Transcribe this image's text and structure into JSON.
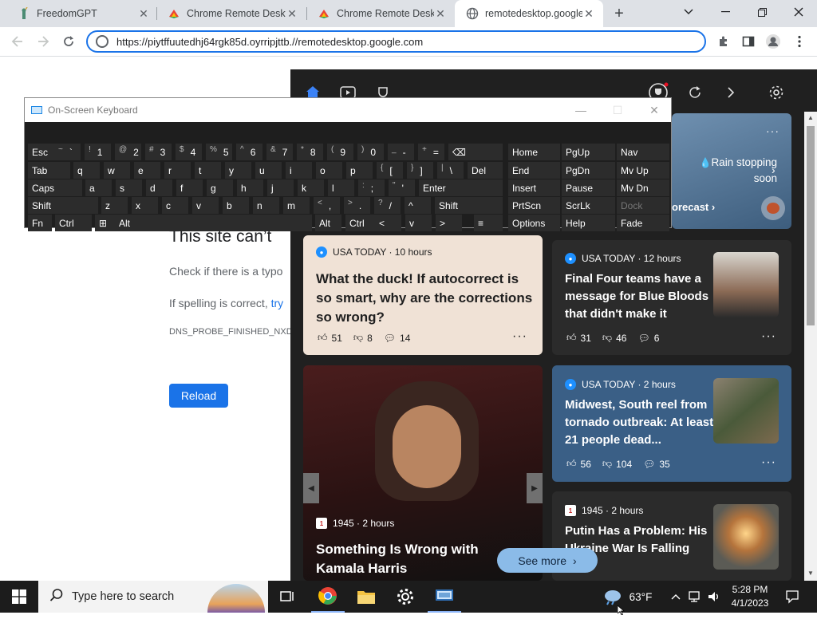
{
  "browser": {
    "tabs": [
      {
        "label": "FreedomGPT",
        "icon": "statue-of-liberty-icon",
        "active": false
      },
      {
        "label": "Chrome Remote Deskt",
        "icon": "chrome-remote-desktop-icon",
        "active": false
      },
      {
        "label": "Chrome Remote Deskt",
        "icon": "chrome-remote-desktop-icon",
        "active": false
      },
      {
        "label": "remotedesktop.google.",
        "icon": "globe-icon",
        "active": true
      }
    ],
    "new_tab": "+",
    "url": "https://piytffuutedhj64rgk85d.oyrripjttb.//remotedesktop.google.com"
  },
  "error_page": {
    "title": "This site can’t",
    "line1": "Check if there is a typo",
    "line2_prefix": "If spelling is correct, ",
    "line2_link": "try",
    "code": "DNS_PROBE_FINISHED_NXD",
    "reload": "Reload"
  },
  "news": {
    "weather_text": "Rain stopping soon",
    "forecast": "orecast",
    "cards": [
      {
        "source": "USA TODAY · 10 hours",
        "headline": "What the duck! If autocorrect is so smart, why are the corrections so wrong?",
        "likes": "51",
        "dislikes": "8",
        "comments": "14"
      },
      {
        "source": "USA TODAY · 12 hours",
        "headline": "Final Four teams have a message for Blue Bloods that didn't make it",
        "likes": "31",
        "dislikes": "46",
        "comments": "6"
      },
      {
        "source": "USA TODAY · 2 hours",
        "headline": "Midwest, South reel from tornado outbreak: At least 21 people dead...",
        "likes": "56",
        "dislikes": "104",
        "comments": "35"
      },
      {
        "source": "1945 · 2 hours",
        "headline": "Something Is Wrong with Kamala Harris"
      },
      {
        "source": "1945 · 2 hours",
        "headline": "Putin Has a Problem: His Ukraine War Is Falling"
      }
    ],
    "see_more": "See more"
  },
  "keyboard": {
    "title": "On-Screen Keyboard",
    "rows": [
      [
        [
          "Esc",
          ""
        ],
        [
          "`",
          "~"
        ],
        [
          "1",
          "!"
        ],
        [
          "2",
          "@"
        ],
        [
          "3",
          "#"
        ],
        [
          "4",
          "$"
        ],
        [
          "5",
          "%"
        ],
        [
          "6",
          "^"
        ],
        [
          "7",
          "&"
        ],
        [
          "8",
          "*"
        ],
        [
          "9",
          "("
        ],
        [
          "0",
          ")"
        ],
        [
          "-",
          "_"
        ],
        [
          "=",
          "+"
        ],
        [
          "⌫",
          ""
        ]
      ],
      [
        [
          "Tab",
          ""
        ],
        [
          "q",
          ""
        ],
        [
          "w",
          ""
        ],
        [
          "e",
          ""
        ],
        [
          "r",
          ""
        ],
        [
          "t",
          ""
        ],
        [
          "y",
          ""
        ],
        [
          "u",
          ""
        ],
        [
          "i",
          ""
        ],
        [
          "o",
          ""
        ],
        [
          "p",
          ""
        ],
        [
          "[",
          "{"
        ],
        [
          "]",
          "}"
        ],
        [
          "\\",
          "|"
        ],
        [
          "Del",
          ""
        ]
      ],
      [
        [
          "Caps",
          ""
        ],
        [
          "a",
          ""
        ],
        [
          "s",
          ""
        ],
        [
          "d",
          ""
        ],
        [
          "f",
          ""
        ],
        [
          "g",
          ""
        ],
        [
          "h",
          ""
        ],
        [
          "j",
          ""
        ],
        [
          "k",
          ""
        ],
        [
          "l",
          ""
        ],
        [
          ";",
          ":"
        ],
        [
          "'",
          "\""
        ],
        [
          "Enter",
          ""
        ]
      ],
      [
        [
          "Shift",
          ""
        ],
        [
          "z",
          ""
        ],
        [
          "x",
          ""
        ],
        [
          "c",
          ""
        ],
        [
          "v",
          ""
        ],
        [
          "b",
          ""
        ],
        [
          "n",
          ""
        ],
        [
          "m",
          ""
        ],
        [
          ",",
          "<"
        ],
        [
          ".",
          ">"
        ],
        [
          "/",
          "?"
        ],
        [
          "^",
          ""
        ],
        [
          "Shift",
          ""
        ]
      ],
      [
        [
          "Fn",
          ""
        ],
        [
          "Ctrl",
          ""
        ],
        [
          "⊞",
          ""
        ],
        [
          "Alt",
          ""
        ],
        [
          "",
          ""
        ],
        [
          "Alt",
          ""
        ],
        [
          "Ctrl",
          ""
        ],
        [
          "<",
          ""
        ],
        [
          "v",
          ""
        ],
        [
          ">",
          ""
        ],
        [
          "≡",
          ""
        ]
      ]
    ],
    "nav_keys": [
      [
        "Home",
        "PgUp",
        "Nav"
      ],
      [
        "End",
        "PgDn",
        "Mv Up"
      ],
      [
        "Insert",
        "Pause",
        "Mv Dn"
      ],
      [
        "PrtScn",
        "ScrLk",
        "Dock"
      ],
      [
        "Options",
        "Help",
        "Fade"
      ]
    ]
  },
  "taskbar": {
    "search_placeholder": "Type here to search",
    "temperature": "63°F",
    "time": "5:28 PM",
    "date": "4/1/2023"
  }
}
